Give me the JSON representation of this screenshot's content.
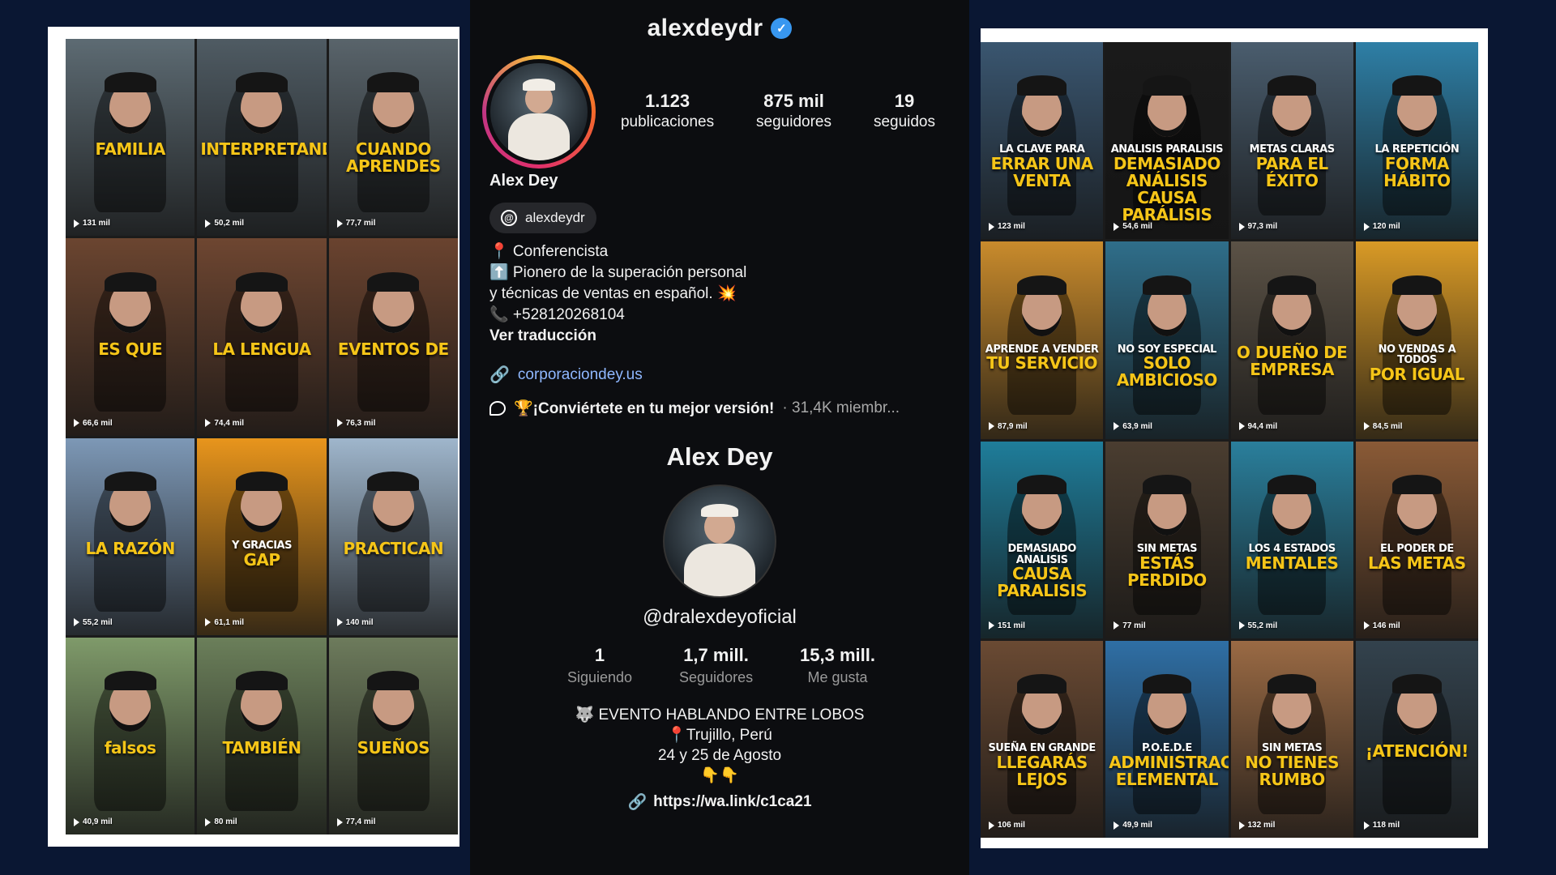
{
  "instagram": {
    "username": "alexdeydr",
    "stats": [
      {
        "value": "1.123",
        "label": "publicaciones"
      },
      {
        "value": "875 mil",
        "label": "seguidores"
      },
      {
        "value": "19",
        "label": "seguidos"
      }
    ],
    "display_name": "Alex Dey",
    "threads_handle": "alexdeydr",
    "bio_lines": [
      "📍 Conferencista",
      "⬆️ Pionero de la superación personal",
      "y técnicas de ventas en español. 💥",
      "📞 +528120268104"
    ],
    "translate_label": "Ver traducción",
    "website": "corporaciondey.us",
    "channel_name": "🏆¡Conviértete en tu mejor versión!",
    "channel_members": "· 31,4K miembr..."
  },
  "tiktok": {
    "display_name": "Alex Dey",
    "handle": "@dralexdeyoficial",
    "stats": [
      {
        "value": "1",
        "label": "Siguiendo"
      },
      {
        "value": "1,7 mill.",
        "label": "Seguidores"
      },
      {
        "value": "15,3 mill.",
        "label": "Me gusta"
      }
    ],
    "bio_lines": [
      "🐺 EVENTO HABLANDO ENTRE LOBOS",
      "📍Trujillo, Perú",
      "24 y 25 de Agosto",
      "👇👇"
    ],
    "link": "https://wa.link/c1ca21"
  },
  "left_reels": [
    {
      "top": "",
      "caption": "FAMILIA",
      "views": "131 mil",
      "bg": "#5d6b73"
    },
    {
      "top": "",
      "caption": "INTERPRETANDO",
      "views": "50,2 mil",
      "bg": "#4f5b63"
    },
    {
      "top": "",
      "caption": "CUANDO APRENDES",
      "views": "77,7 mil",
      "bg": "#59646b"
    },
    {
      "top": "",
      "caption": "ES QUE",
      "views": "66,6 mil",
      "bg": "#6b4530"
    },
    {
      "top": "",
      "caption": "LA LENGUA",
      "views": "74,4 mil",
      "bg": "#6e4631"
    },
    {
      "top": "",
      "caption": "EVENTOS DE",
      "views": "76,3 mil",
      "bg": "#6a432f"
    },
    {
      "top": "",
      "caption": "LA RAZÓN",
      "views": "55,2 mil",
      "bg": "#7d98b6"
    },
    {
      "top": "Y GRACIAS",
      "caption": "GAP",
      "views": "61,1 mil",
      "bg": "#e8951c"
    },
    {
      "top": "",
      "caption": "PRACTICAN",
      "views": "140 mil",
      "bg": "#9fb6cc"
    },
    {
      "top": "",
      "caption": "falsos",
      "views": "40,9 mil",
      "bg": "#7f9a6a"
    },
    {
      "top": "",
      "caption": "TAMBIÉN",
      "views": "80 mil",
      "bg": "#6b7f5a"
    },
    {
      "top": "",
      "caption": "SUEÑOS",
      "views": "77,4 mil",
      "bg": "#6d7b5c"
    }
  ],
  "right_reels": [
    {
      "top": "LA CLAVE PARA",
      "caption": "ERRAR UNA VENTA",
      "views": "123 mil",
      "bg": "#3a5670"
    },
    {
      "top": "ANALISIS PARALISIS",
      "caption": "DEMASIADO ANÁLISIS CAUSA PARÁLISIS",
      "views": "54,6 mil",
      "bg": "#1a1a1a"
    },
    {
      "top": "METAS CLARAS",
      "caption": "PARA EL ÉXITO",
      "views": "97,3 mil",
      "bg": "#4a5d6e"
    },
    {
      "top": "LA REPETICIÓN",
      "caption": "FORMA HÁBITO",
      "views": "120 mil",
      "bg": "#2e7fa6"
    },
    {
      "top": "APRENDE A VENDER",
      "caption": "TU SERVICIO",
      "views": "87,9 mil",
      "bg": "#c98b2c"
    },
    {
      "top": "NO SOY ESPECIAL",
      "caption": "SOLO AMBICIOSO",
      "views": "63,9 mil",
      "bg": "#2f6e8a"
    },
    {
      "top": "",
      "caption": "O DUEÑO DE EMPRESA",
      "views": "94,4 mil",
      "bg": "#5b5246"
    },
    {
      "top": "NO VENDAS A TODOS",
      "caption": "POR IGUAL",
      "views": "84,5 mil",
      "bg": "#d99a26"
    },
    {
      "top": "DEMASIADO ANALISIS",
      "caption": "CAUSA PARALISIS",
      "views": "151 mil",
      "bg": "#1f7d9a"
    },
    {
      "top": "SIN METAS",
      "caption": "ESTÁS PERDIDO",
      "views": "77 mil",
      "bg": "#4a3d30"
    },
    {
      "top": "LOS 4 ESTADOS",
      "caption": "MENTALES",
      "views": "55,2 mil",
      "bg": "#2a7f9c"
    },
    {
      "top": "EL PODER DE",
      "caption": "LAS METAS",
      "views": "146 mil",
      "bg": "#8a5a36"
    },
    {
      "top": "SUEÑA EN GRANDE",
      "caption": "LLEGARÁS LEJOS",
      "views": "106 mil",
      "bg": "#6a4a33"
    },
    {
      "top": "P.O.E.D.E",
      "caption": "ADMINISTRACIÓN ELEMENTAL",
      "views": "49,9 mil",
      "bg": "#2f6fa5"
    },
    {
      "top": "SIN METAS",
      "caption": "NO TIENES RUMBO",
      "views": "132 mil",
      "bg": "#9a6a44"
    },
    {
      "top": "",
      "caption": "¡ATENCIÓN!",
      "views": "118 mil",
      "bg": "#33424d"
    }
  ]
}
